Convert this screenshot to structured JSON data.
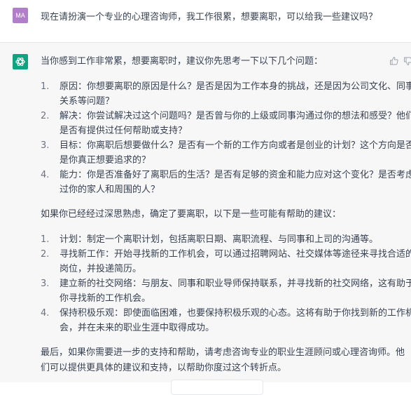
{
  "user": {
    "avatar_initials": "MA",
    "message": "现在请扮演一个专业的心理咨询师，我工作很累，想要离职，可以给我一些建议吗？"
  },
  "assistant": {
    "icon": "openai-logo-icon",
    "actions": [
      "thumbs-up-icon",
      "thumbs-down-icon"
    ],
    "intro": "当你感到工作非常累，想要离职时，建议你先思考一下以下几个问题：",
    "questions": [
      {
        "num": "1.",
        "lines": [
          "原因：你想要离职的原因是什么？是否是因为工作本身的挑战，还是因为公司文化、同事",
          "关系等问题？"
        ]
      },
      {
        "num": "2.",
        "lines": [
          "解决：你尝试解决过这个问题吗？是否曾与你的上级或同事沟通过你的想法和感受？他们",
          "是否有提供过任何帮助或支持？"
        ]
      },
      {
        "num": "3.",
        "lines": [
          "目标：你离职后想要做什么？是否有一个新的工作方向或者是创业的计划？这个方向是否",
          "是你真正想要追求的？"
        ]
      },
      {
        "num": "4.",
        "lines": [
          "能力：你是否准备好了离职后的生活？是否有足够的资金和能力应对这个变化？是否考虑",
          "过你的家人和周围的人？"
        ]
      }
    ],
    "middle": "如果你已经经过深思熟虑，确定了要离职，以下是一些可能有帮助的建议：",
    "suggestions": [
      {
        "num": "1.",
        "lines": [
          "计划：制定一个离职计划，包括离职日期、离职流程、与同事和上司的沟通等。"
        ]
      },
      {
        "num": "2.",
        "lines": [
          "寻找新工作：开始寻找新的工作机会，可以通过招聘网站、社交媒体等途径来寻找合适的",
          "岗位，并投递简历。"
        ]
      },
      {
        "num": "3.",
        "lines": [
          "建立新的社交网络：与朋友、同事和职业导师保持联系，并寻找新的社交网络，这有助于",
          "你寻找新的工作机会。"
        ]
      },
      {
        "num": "4.",
        "lines": [
          "保持积极乐观：即使面临困难，也要保持积极乐观的心态。这将有助于你找到新的工作机",
          "会，并在未来的职业生涯中取得成功。"
        ]
      }
    ],
    "closing": [
      "最后，如果你需要进一步的支持和帮助，请考虑咨询专业的职业生涯顾问或心理咨询师。他",
      "们可以提供更具体的建议和支持，以帮助你度过这个转折点。"
    ]
  },
  "colors": {
    "avatar_bg": "#b17fc9",
    "gpt_green": "#10a37f",
    "assistant_bg": "#f7f7f8",
    "text": "#374151"
  }
}
